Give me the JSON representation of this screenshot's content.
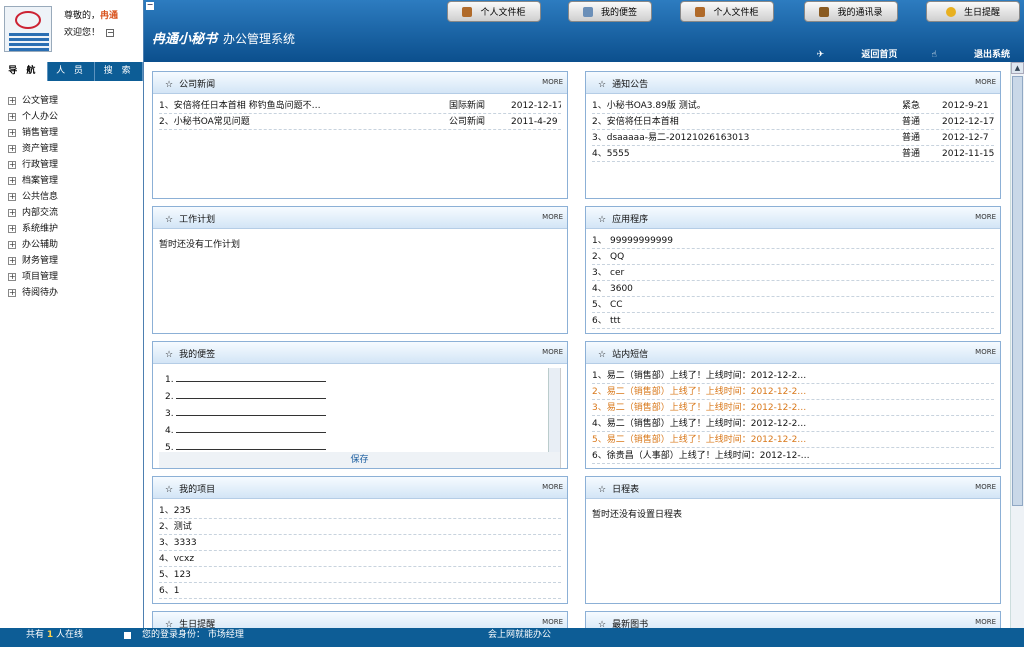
{
  "user": {
    "greeting": "尊敬的，",
    "name": "冉通",
    "welcome": "欢迎您！",
    "toggle": "⊟"
  },
  "sidebar": {
    "tabs": [
      "导 航",
      "人 员",
      "搜 索"
    ],
    "items": [
      "公文管理",
      "个人办公",
      "销售管理",
      "资产管理",
      "行政管理",
      "档案管理",
      "公共信息",
      "内部交流",
      "系统维护",
      "办公辅助",
      "财务管理",
      "项目管理",
      "待阅待办"
    ]
  },
  "header": {
    "brand": "冉通小秘书",
    "subtitle": "办公管理系统",
    "buttons": [
      "个人文件柜",
      "我的便签",
      "个人文件柜",
      "我的通讯录",
      "生日提醒"
    ],
    "links": [
      "返回首页",
      "退出系统"
    ]
  },
  "more": "MORE",
  "panels": {
    "company_news": {
      "title": "公司新闻",
      "rows": [
        {
          "text": "1、安倍将任日本首相 称钓鱼岛问题不…",
          "cat": "国际新闻",
          "date": "2012-12-17"
        },
        {
          "text": "2、小秘书OA常见问题",
          "cat": "公司新闻",
          "date": "2011-4-29"
        }
      ]
    },
    "notices": {
      "title": "通知公告",
      "rows": [
        {
          "text": "1、小秘书OA3.89版 测试。",
          "level": "紧急",
          "date": "2012-9-21"
        },
        {
          "text": "2、安倍将任日本首相",
          "level": "普通",
          "date": "2012-12-17"
        },
        {
          "text": "3、dsaaaaa-易二-20121026163013",
          "level": "普通",
          "date": "2012-12-7"
        },
        {
          "text": "4、5555",
          "level": "普通",
          "date": "2012-11-15"
        }
      ]
    },
    "work_plan": {
      "title": "工作计划",
      "empty": "暂时还没有工作计划"
    },
    "apps": {
      "title": "应用程序",
      "rows": [
        {
          "n": "1、",
          "v": "99999999999"
        },
        {
          "n": "2、",
          "v": "QQ"
        },
        {
          "n": "3、",
          "v": "cer"
        },
        {
          "n": "4、",
          "v": "3600"
        },
        {
          "n": "5、",
          "v": "CC"
        },
        {
          "n": "6、",
          "v": "ttt"
        }
      ]
    },
    "notes": {
      "title": "我的便签",
      "rows": [
        "1.",
        "2.",
        "3.",
        "4.",
        "5."
      ],
      "save": "保存"
    },
    "messages": {
      "title": "站内短信",
      "rows": [
        {
          "text": "1、易二（销售部）上线了！上线时间：2012-12-2…",
          "hl": false
        },
        {
          "text": "2、易二（销售部）上线了！上线时间：2012-12-2…",
          "hl": true
        },
        {
          "text": "3、易二（销售部）上线了！上线时间：2012-12-2…",
          "hl": true
        },
        {
          "text": "4、易二（销售部）上线了！上线时间：2012-12-2…",
          "hl": false
        },
        {
          "text": "5、易二（销售部）上线了！上线时间：2012-12-2…",
          "hl": true
        },
        {
          "text": "6、徐贵昌（人事部）上线了！上线时间：2012-12-…",
          "hl": false
        }
      ]
    },
    "projects": {
      "title": "我的项目",
      "rows": [
        "1、235",
        "2、测试",
        "3、3333",
        "4、vcxz",
        "5、123",
        "6、1"
      ]
    },
    "schedule": {
      "title": "日程表",
      "empty": "暂时还没有设置日程表"
    },
    "birthday": {
      "title": "生日提醒"
    },
    "books": {
      "title": "最新图书"
    }
  },
  "footer": {
    "online_pre": "共有",
    "online_count": "1",
    "online_post": "人在线",
    "role_label": "您的登录身份：",
    "role": "市场经理",
    "slogan": "会上网就能办公"
  },
  "colors": {
    "highlight": "#d9781a",
    "header": "#0b4f8d",
    "panel_border": "#8cb0d6"
  }
}
